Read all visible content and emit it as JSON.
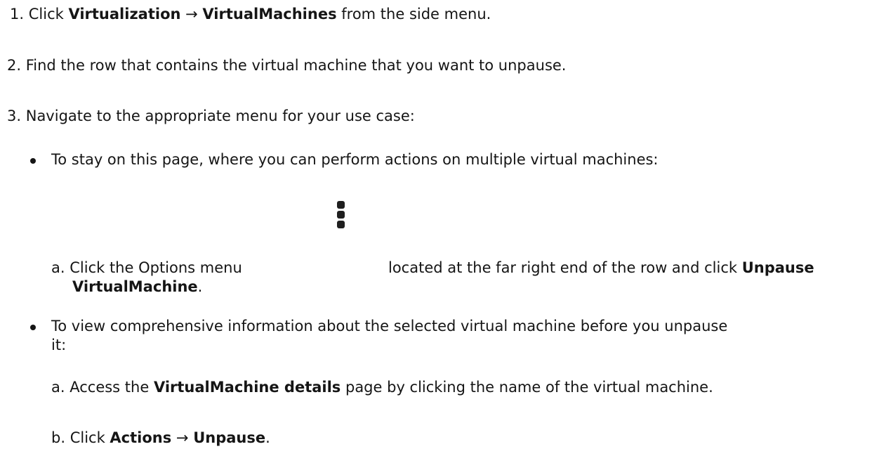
{
  "steps": [
    {
      "number": "1.",
      "text_prefix": "Click ",
      "bold_1": "Virtualization",
      "arrow": " → ",
      "bold_2": "VirtualMachines",
      "text_suffix": " from the side menu."
    },
    {
      "number": "2.",
      "text": "Find the row that contains the virtual machine that you want to unpause."
    },
    {
      "number": "3.",
      "text": "Navigate to the appropriate menu for your use case:"
    }
  ],
  "bullets": [
    {
      "text": "To stay on this page, where you can perform actions on multiple virtual machines:",
      "substeps": [
        {
          "letter": "a.",
          "text_prefix": "Click the Options menu",
          "icon": "kebab-options-icon",
          "text_middle": "located at the far right end of the row and click ",
          "bold_1": "Unpause",
          "bold_2": "VirtualMachine",
          "text_suffix": "."
        }
      ]
    },
    {
      "text_line_1": "To view comprehensive information about the selected virtual machine before you unpause",
      "text_line_2": "it:",
      "substeps": [
        {
          "letter": "a.",
          "text_prefix": "Access the ",
          "bold": "VirtualMachine details",
          "text_suffix": " page by clicking the name of the virtual machine."
        },
        {
          "letter": "b.",
          "text_prefix": "Click ",
          "bold_1": "Actions",
          "arrow": " → ",
          "bold_2": "Unpause",
          "text_suffix": "."
        }
      ]
    }
  ]
}
